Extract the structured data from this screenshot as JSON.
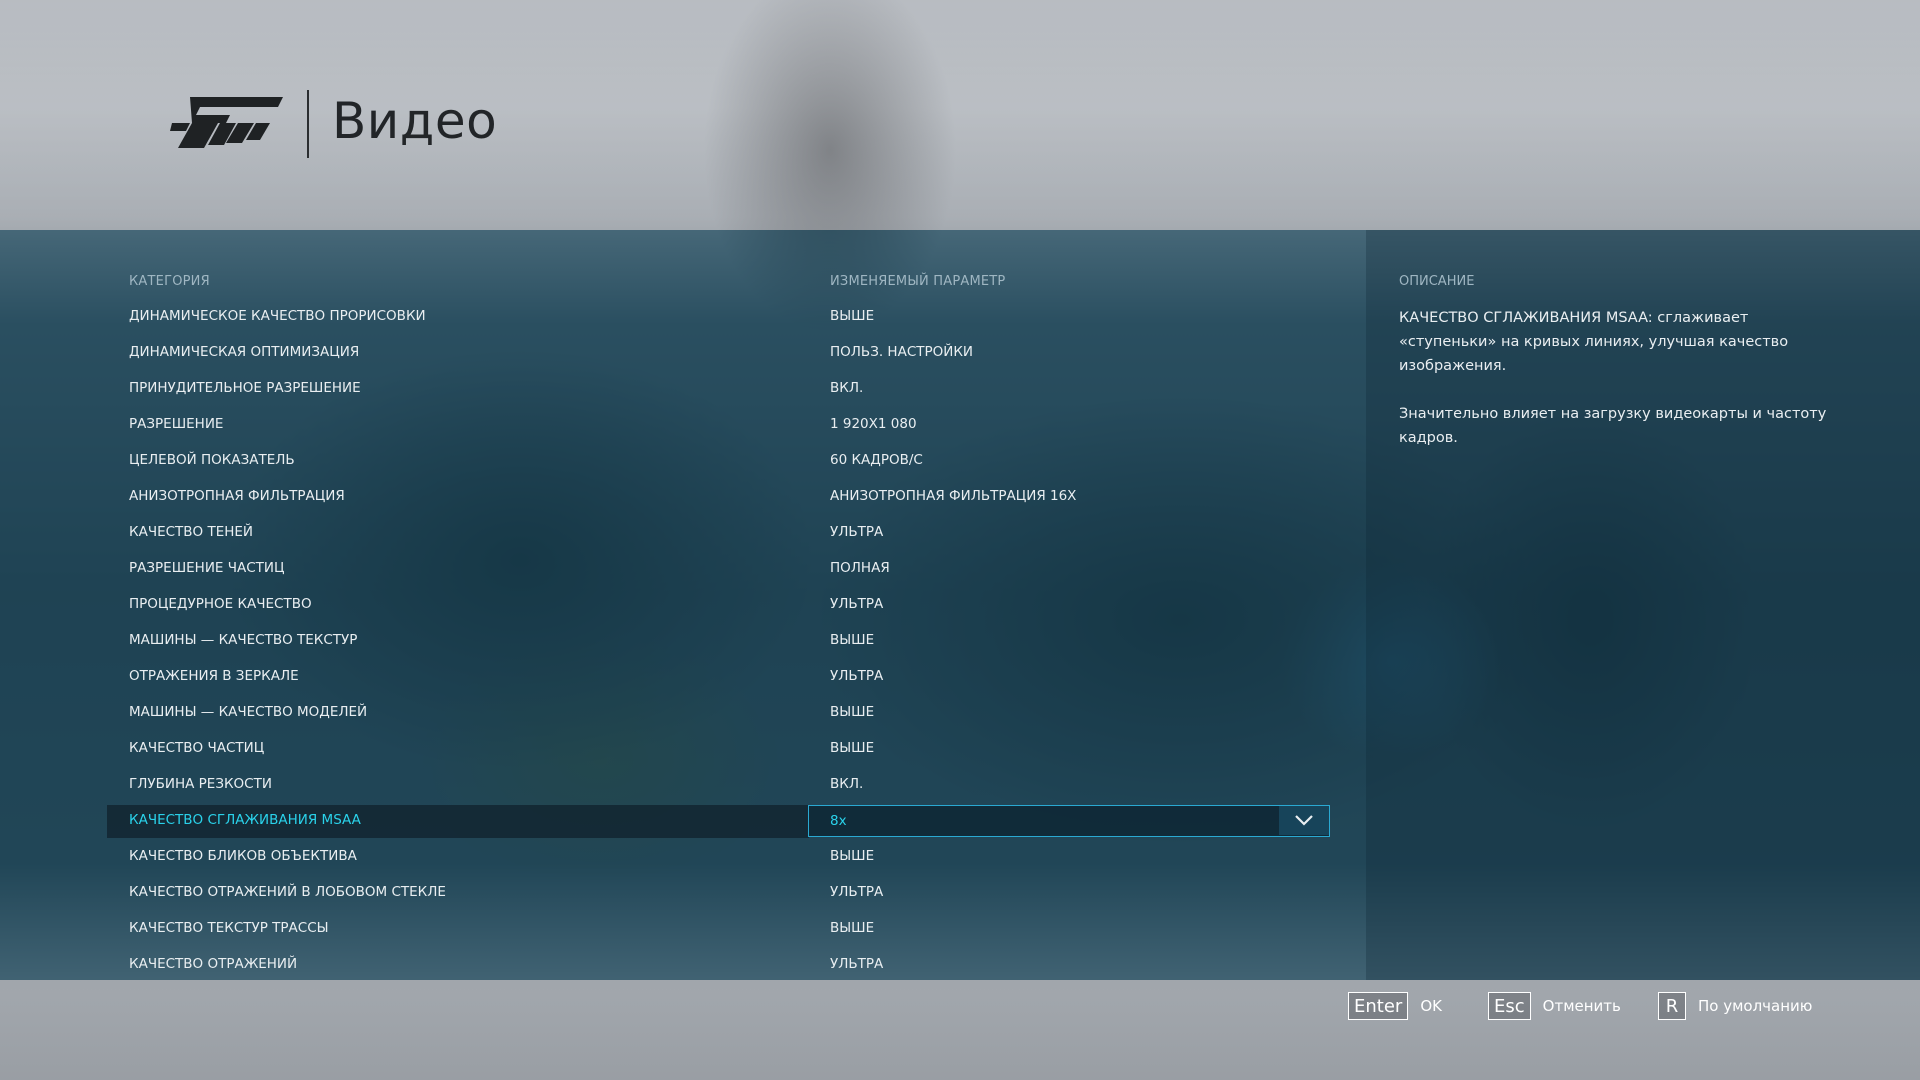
{
  "header": {
    "title": "Видео"
  },
  "columns": {
    "category": "КАТЕГОРИЯ",
    "value": "ИЗМЕНЯЕМЫЙ ПАРАМЕТР"
  },
  "settings": [
    {
      "category": "ДИНАМИЧЕСКОЕ КАЧЕСТВО ПРОРИСОВКИ",
      "value": "ВЫШЕ"
    },
    {
      "category": "ДИНАМИЧЕСКАЯ ОПТИМИЗАЦИЯ",
      "value": "ПОЛЬЗ. НАСТРОЙКИ"
    },
    {
      "category": "ПРИНУДИТЕЛЬНОЕ РАЗРЕШЕНИЕ",
      "value": "ВКЛ."
    },
    {
      "category": "РАЗРЕШЕНИЕ",
      "value": "1 920x1 080"
    },
    {
      "category": "ЦЕЛЕВОЙ ПОКАЗАТЕЛЬ",
      "value": "60 КАДРОВ/С"
    },
    {
      "category": "АНИЗОТРОПНАЯ ФИЛЬТРАЦИЯ",
      "value": "АНИЗОТРОПНАЯ ФИЛЬТРАЦИЯ 16X"
    },
    {
      "category": "КАЧЕСТВО ТЕНЕЙ",
      "value": "УЛЬТРА"
    },
    {
      "category": "РАЗРЕШЕНИЕ ЧАСТИЦ",
      "value": "ПОЛНАЯ"
    },
    {
      "category": "ПРОЦЕДУРНОЕ КАЧЕСТВО",
      "value": "УЛЬТРА"
    },
    {
      "category": "МАШИНЫ — КАЧЕСТВО ТЕКСТУР",
      "value": "ВЫШЕ"
    },
    {
      "category": "ОТРАЖЕНИЯ В ЗЕРКАЛЕ",
      "value": "УЛЬТРА"
    },
    {
      "category": "МАШИНЫ — КАЧЕСТВО МОДЕЛЕЙ",
      "value": "ВЫШЕ"
    },
    {
      "category": "КАЧЕСТВО ЧАСТИЦ",
      "value": "ВЫШЕ"
    },
    {
      "category": "ГЛУБИНА РЕЗКОСТИ",
      "value": "ВКЛ."
    },
    {
      "category": "КАЧЕСТВО СГЛАЖИВАНИЯ MSAA",
      "value": "8x",
      "selected": true
    },
    {
      "category": "КАЧЕСТВО БЛИКОВ ОБЪЕКТИВА",
      "value": "ВЫШЕ"
    },
    {
      "category": "КАЧЕСТВО ОТРАЖЕНИЙ В ЛОБОВОМ СТЕКЛЕ",
      "value": "УЛЬТРА"
    },
    {
      "category": "КАЧЕСТВО ТЕКСТУР ТРАССЫ",
      "value": "ВЫШЕ"
    },
    {
      "category": "КАЧЕСТВО ОТРАЖЕНИЙ",
      "value": "УЛЬТРА"
    }
  ],
  "description": {
    "title": "ОПИСАНИЕ",
    "paragraphs": [
      "КАЧЕСТВО СГЛАЖИВАНИЯ MSAA: сглаживает «ступеньки» на кривых линиях, улучшая качество изображения.",
      "Значительно влияет на загрузку видеокарты и частоту кадров."
    ]
  },
  "footer": {
    "hints": [
      {
        "key": "Enter",
        "label": "OK"
      },
      {
        "key": "Esc",
        "label": "Отменить"
      },
      {
        "key": "R",
        "label": "По умолчанию"
      }
    ]
  },
  "colors": {
    "accent": "#2ad2ea",
    "panel": "#16485f",
    "text": "#e9eef1"
  }
}
